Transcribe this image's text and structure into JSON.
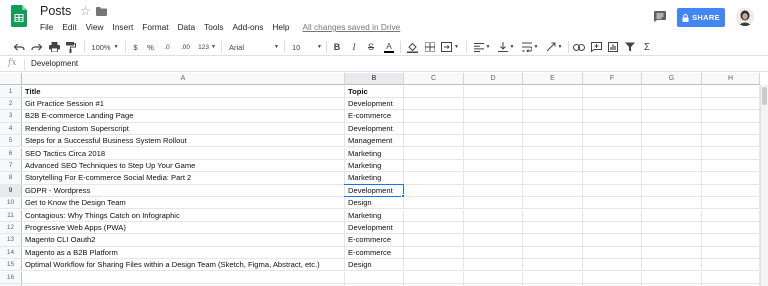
{
  "app": {
    "doc_title": "Posts",
    "menu": [
      "File",
      "Edit",
      "View",
      "Insert",
      "Format",
      "Data",
      "Tools",
      "Add-ons",
      "Help"
    ],
    "save_status": "All changes saved in Drive",
    "share_label": "SHARE",
    "brand_color": "#0f9d58",
    "share_color": "#4285f4"
  },
  "toolbar": {
    "zoom": "100%",
    "currency": "$",
    "percent": "%",
    "dec_decrease": ".0",
    "dec_increase": ".00",
    "more_formats": "123",
    "font": "Arial",
    "font_size": "10",
    "bold": "B",
    "italic": "I",
    "strike": "S",
    "text_color": "A",
    "sum": "Σ"
  },
  "formula_bar": {
    "fx_label": "fx",
    "value": "Development"
  },
  "grid": {
    "columns": [
      "A",
      "B",
      "C",
      "D",
      "E",
      "F",
      "G",
      "H"
    ],
    "active_column": "B",
    "active_row": "9",
    "rows": [
      {
        "num": "1",
        "a": "Title",
        "b": "Topic",
        "bold": true
      },
      {
        "num": "2",
        "a": "Git Practice Session #1",
        "b": "Development"
      },
      {
        "num": "3",
        "a": "B2B E-commerce Landing Page",
        "b": "E-commerce"
      },
      {
        "num": "4",
        "a": "Rendering Custom Superscript",
        "b": "Development"
      },
      {
        "num": "5",
        "a": "Steps for a Successful Business System Rollout",
        "b": "Management"
      },
      {
        "num": "6",
        "a": "SEO Tactics Circa 2018",
        "b": "Marketing"
      },
      {
        "num": "7",
        "a": "Advanced SEO Techniques to Step Up Your Game",
        "b": "Marketing"
      },
      {
        "num": "8",
        "a": "Storytelling For E-commerce Social Media: Part 2",
        "b": "Marketing"
      },
      {
        "num": "9",
        "a": "GDPR - Wordpress",
        "b": "Development"
      },
      {
        "num": "10",
        "a": "Get to Know the Design Team",
        "b": "Design"
      },
      {
        "num": "11",
        "a": "Contagious: Why Things Catch on Infographic",
        "b": "Marketing"
      },
      {
        "num": "12",
        "a": "Progressive Web Apps (PWA)",
        "b": "Development"
      },
      {
        "num": "13",
        "a": "Magento CLI Oauth2",
        "b": "E-commerce"
      },
      {
        "num": "14",
        "a": "Magento as a B2B Platform",
        "b": "E-commerce"
      },
      {
        "num": "15",
        "a": "Optimal Workflow for Sharing Files within a Design Team (Sketch, Figma, Abstract, etc.)",
        "b": "Design"
      },
      {
        "num": "16",
        "a": "",
        "b": ""
      },
      {
        "num": "17",
        "a": "",
        "b": ""
      }
    ]
  }
}
